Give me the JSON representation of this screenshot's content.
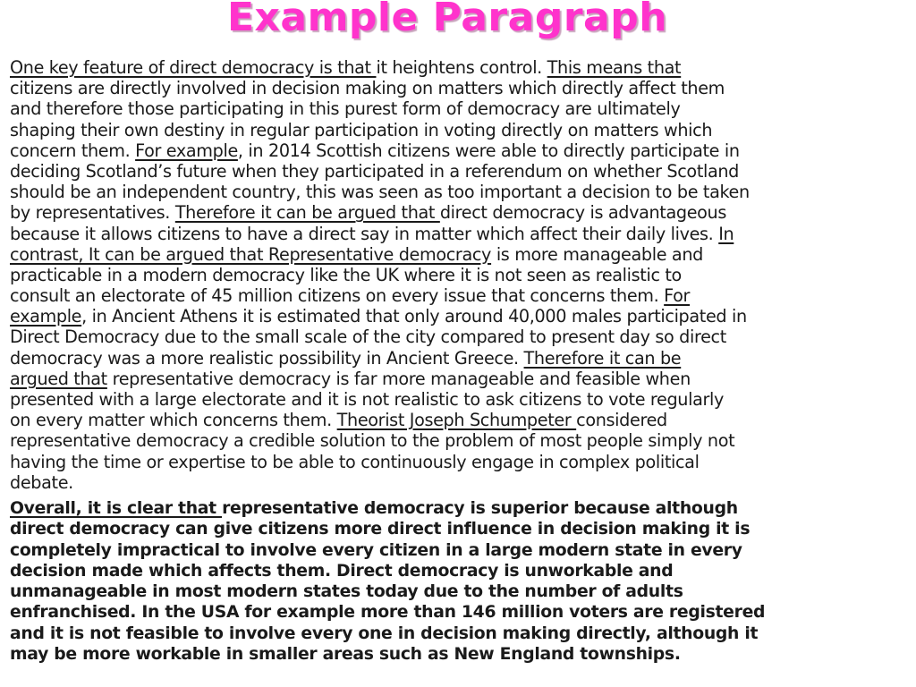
{
  "title": "Example Paragraph",
  "colors": {
    "title": "#ff33cc",
    "text": "#1a1a1a",
    "background": "#ffffff"
  },
  "paragraph1": {
    "lines": [
      [
        {
          "t": "One key feature of direct democracy is that ",
          "u": true
        },
        {
          "t": "it heightens control. "
        },
        {
          "t": "This means that",
          "u": true
        }
      ],
      [
        {
          "t": "citizens are directly involved in decision making on matters which directly affect them"
        }
      ],
      [
        {
          "t": "and therefore those participating in this purest form of democracy are ultimately"
        }
      ],
      [
        {
          "t": "shaping their own destiny in regular participation in voting directly on matters which"
        }
      ],
      [
        {
          "t": "concern them. "
        },
        {
          "t": "For example",
          "u": true
        },
        {
          "t": ", in 2014 Scottish citizens were able to directly participate in"
        }
      ],
      [
        {
          "t": "deciding Scotland’s future when they participated in a referendum on whether Scotland"
        }
      ],
      [
        {
          "t": "should be an independent country, this was seen as too important a decision to be taken"
        }
      ],
      [
        {
          "t": "by representatives. "
        },
        {
          "t": "Therefore it can be argued that ",
          "u": true
        },
        {
          "t": "direct democracy is advantageous"
        }
      ],
      [
        {
          "t": "because it allows citizens to have a direct say in matter which affect their daily lives. "
        },
        {
          "t": "In",
          "u": true
        }
      ],
      [
        {
          "t": "contrast, It can be argued that Representative democracy",
          "u": true
        },
        {
          "t": " is more manageable and"
        }
      ],
      [
        {
          "t": "practicable in a modern democracy like the UK where it is not seen as realistic to"
        }
      ],
      [
        {
          "t": "consult an electorate of 45 million citizens on every issue that concerns them. "
        },
        {
          "t": "For",
          "u": true
        }
      ],
      [
        {
          "t": "example",
          "u": true
        },
        {
          "t": ", in Ancient Athens it is estimated that only around 40,000 males participated in"
        }
      ],
      [
        {
          "t": "Direct Democracy due to the small scale of the city compared to present day so direct"
        }
      ],
      [
        {
          "t": "democracy was a more realistic possibility in Ancient Greece. "
        },
        {
          "t": "Therefore it can be",
          "u": true
        }
      ],
      [
        {
          "t": "argued that",
          "u": true
        },
        {
          "t": " representative democracy is far more manageable and feasible when"
        }
      ],
      [
        {
          "t": "presented with a large electorate and it is not realistic to ask citizens to vote regularly"
        }
      ],
      [
        {
          "t": "on every matter which concerns them.  "
        },
        {
          "t": "Theorist Joseph Schumpeter ",
          "u": true
        },
        {
          "t": "considered"
        }
      ],
      [
        {
          "t": "representative democracy a credible solution to the problem of most people simply not"
        }
      ],
      [
        {
          "t": "having the time or expertise to be able to continuously engage in complex political"
        }
      ],
      [
        {
          "t": "debate."
        }
      ]
    ]
  },
  "paragraph2": {
    "lines": [
      [
        {
          "t": "Overall, it is clear that ",
          "u": true
        },
        {
          "t": "representative democracy is superior because although"
        }
      ],
      [
        {
          "t": "direct democracy can give citizens more direct influence in decision making it is"
        }
      ],
      [
        {
          "t": "completely impractical to involve every citizen in a large modern state in every"
        }
      ],
      [
        {
          "t": "decision made which affects them. Direct democracy is unworkable and"
        }
      ],
      [
        {
          "t": "unmanageable in most modern states today due to the number of adults"
        }
      ],
      [
        {
          "t": "enfranchised. In the USA for example more than 146 million voters are registered"
        }
      ],
      [
        {
          "t": "and it is not feasible to involve every one in decision making directly, although it"
        }
      ],
      [
        {
          "t": "may be more workable in smaller areas such as New England townships."
        }
      ]
    ]
  }
}
